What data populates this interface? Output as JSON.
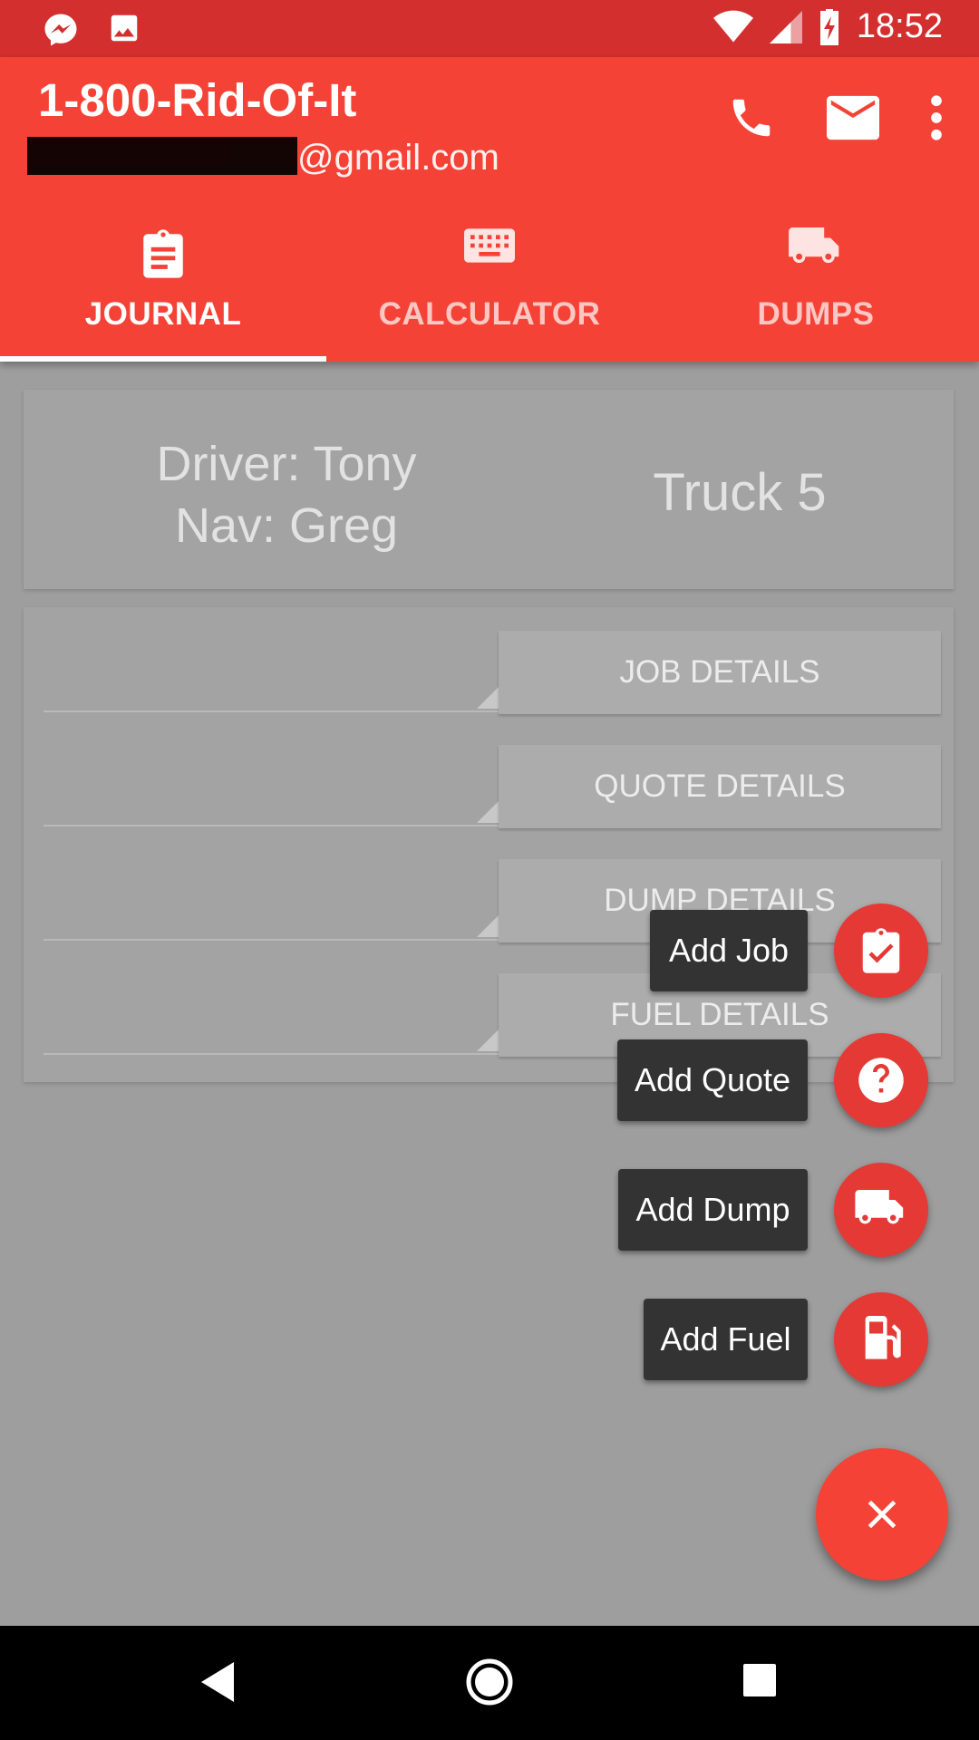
{
  "status_bar": {
    "time": "18:52"
  },
  "app_bar": {
    "title": "1-800-Rid-Of-It",
    "email_suffix": "@gmail.com"
  },
  "tabs": [
    {
      "label": "JOURNAL",
      "icon": "clipboard-icon",
      "selected": true
    },
    {
      "label": "CALCULATOR",
      "icon": "keyboard-icon",
      "selected": false
    },
    {
      "label": "DUMPS",
      "icon": "truck-icon",
      "selected": false
    }
  ],
  "crew": {
    "driver": "Driver: Tony",
    "nav": "Nav: Greg",
    "truck": "Truck 5"
  },
  "details": {
    "job": "JOB DETAILS",
    "quote": "QUOTE DETAILS",
    "dump": "DUMP DETAILS",
    "fuel": "FUEL DETAILS"
  },
  "fab_menu": {
    "add_job": "Add Job",
    "add_quote": "Add Quote",
    "add_dump": "Add Dump",
    "add_fuel": "Add Fuel"
  },
  "colors": {
    "primary": "#f44336",
    "primary_dark": "#d32f2f",
    "scrim": "#9e9e9e"
  }
}
